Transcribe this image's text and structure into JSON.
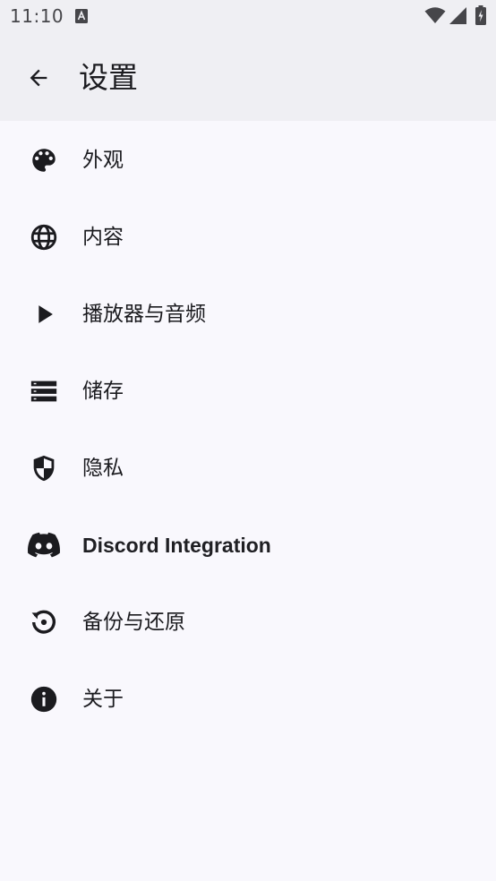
{
  "status_bar": {
    "time": "11:10"
  },
  "header": {
    "title": "设置"
  },
  "settings": {
    "items": [
      {
        "label": "外观",
        "icon": "palette-icon"
      },
      {
        "label": "内容",
        "icon": "globe-icon"
      },
      {
        "label": "播放器与音频",
        "icon": "play-icon"
      },
      {
        "label": "储存",
        "icon": "storage-icon"
      },
      {
        "label": "隐私",
        "icon": "shield-icon"
      },
      {
        "label": "Discord Integration",
        "icon": "discord-icon"
      },
      {
        "label": "备份与还原",
        "icon": "restore-icon"
      },
      {
        "label": "关于",
        "icon": "info-icon"
      }
    ]
  },
  "colors": {
    "background": "#f9f8fd",
    "app_bar": "#efeff3",
    "text": "#1b1b1f"
  }
}
